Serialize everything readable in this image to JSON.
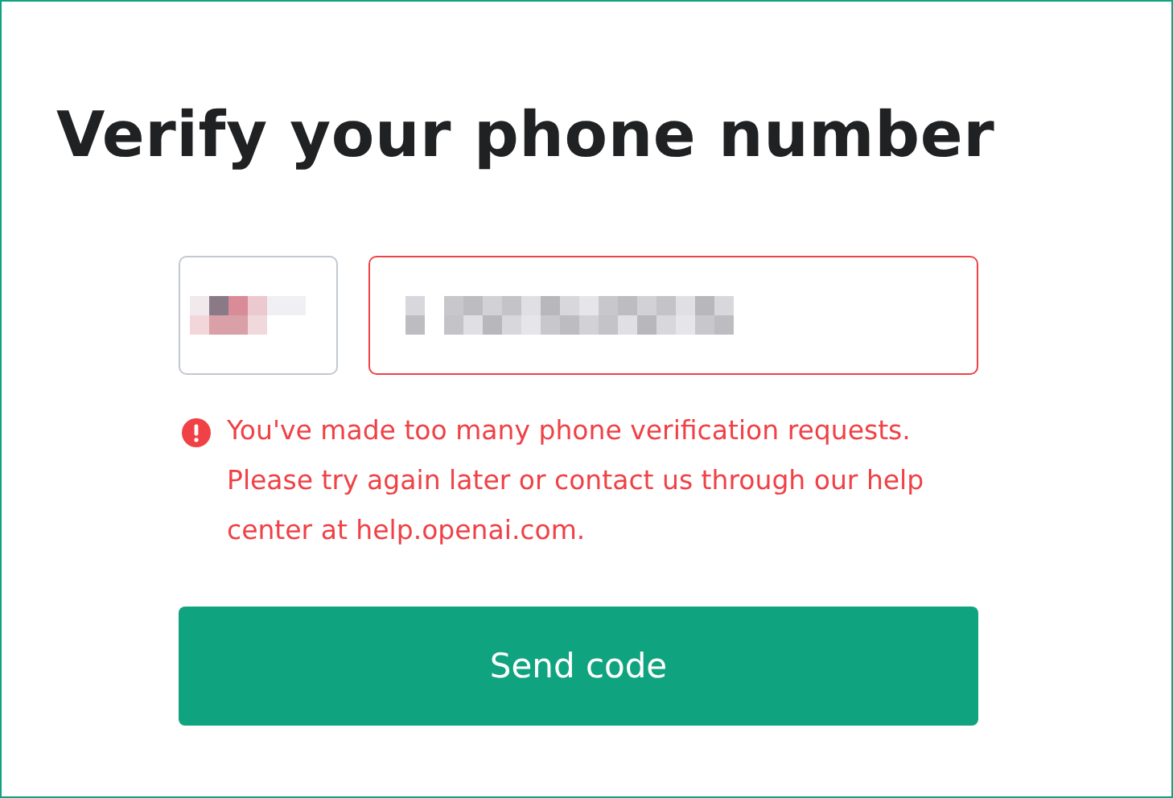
{
  "title": "Verify your phone number",
  "phone": {
    "invalid": true
  },
  "error": {
    "message": "You've made too many phone verification requests. Please try again later or contact us through our help center at help.openai.com."
  },
  "buttons": [
    {
      "label": "Send code",
      "kind": "primary"
    }
  ]
}
